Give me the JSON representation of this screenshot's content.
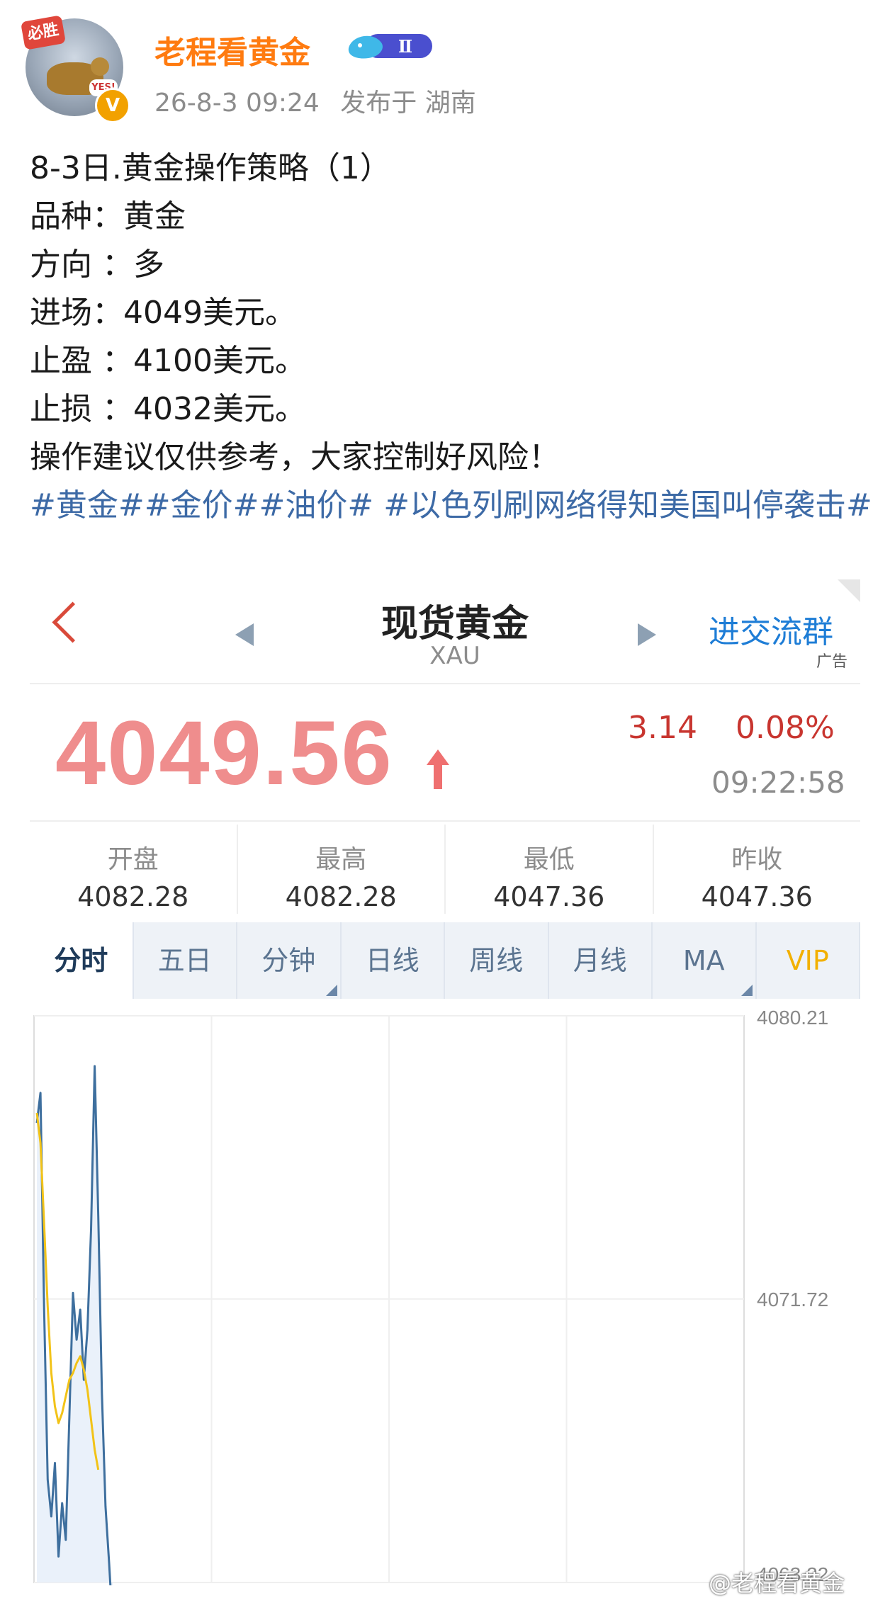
{
  "post": {
    "username": "老程看黄金",
    "vip_level": "Ⅱ",
    "date": "26-8-3 09:24",
    "location": "发布于 湖南",
    "avatar_stamp": "必胜",
    "avatar_yes": "YES!",
    "verify_mark": "V",
    "lines": [
      "8-3日.黄金操作策略（1）",
      "品种：黄金",
      "方向 ：多",
      "进场：4049美元。",
      "止盈 ：4100美元。",
      "止损 ：4032美元。",
      "操作建议仅供参考，大家控制好风险！"
    ],
    "hashtags": [
      "#黄金#",
      "#金价#",
      "#油价#",
      " #以色列刷网络得知美国叫停袭击#"
    ]
  },
  "quote_app": {
    "title": "现货黄金",
    "symbol": "XAU",
    "promo_label": "进交流群",
    "ad_label": "广告",
    "price": "4049.56",
    "change": "3.14",
    "change_pct": "0.08%",
    "time": "09:22:58",
    "stats": [
      {
        "label": "开盘",
        "value": "4082.28"
      },
      {
        "label": "最高",
        "value": "4082.28"
      },
      {
        "label": "最低",
        "value": "4047.36"
      },
      {
        "label": "昨收",
        "value": "4047.36"
      }
    ],
    "tabs": [
      "分时",
      "五日",
      "分钟",
      "日线",
      "周线",
      "月线",
      "MA",
      "VIP"
    ],
    "active_tab": "分时"
  },
  "chart_data": {
    "type": "line",
    "y_ticks": [
      "4080.21",
      "4071.72",
      "4063.22"
    ],
    "ylim": [
      4063.22,
      4080.21
    ],
    "grid": true,
    "series": [
      {
        "color": "#3e6f9e",
        "values": [
          4077.0,
          4077.9,
          4071.5,
          4066.3,
          4065.2,
          4066.8,
          4064.0,
          4065.6,
          4064.5,
          4068.2,
          4071.9,
          4070.5,
          4071.4,
          4069.3,
          4070.8,
          4073.8,
          4078.7,
          4074.2,
          4068.9,
          4065.5,
          4063.8,
          4061.9
        ]
      },
      {
        "color": "#f2c318",
        "values": [
          4077.3,
          4076.4,
          4074.0,
          4071.5,
          4069.5,
          4068.5,
          4068.0,
          4068.3,
          4068.8,
          4069.3,
          4069.5,
          4069.8,
          4070.0,
          4069.6,
          4069.0,
          4068.1,
          4067.2,
          4066.6
        ]
      }
    ]
  },
  "watermark": "@老程看黄金",
  "colors": {
    "username": "#ff7b10",
    "hashtag": "#3d6aa6",
    "price": "#ef8d8d",
    "change": "#c8352f",
    "promo": "#1e7dd6"
  }
}
